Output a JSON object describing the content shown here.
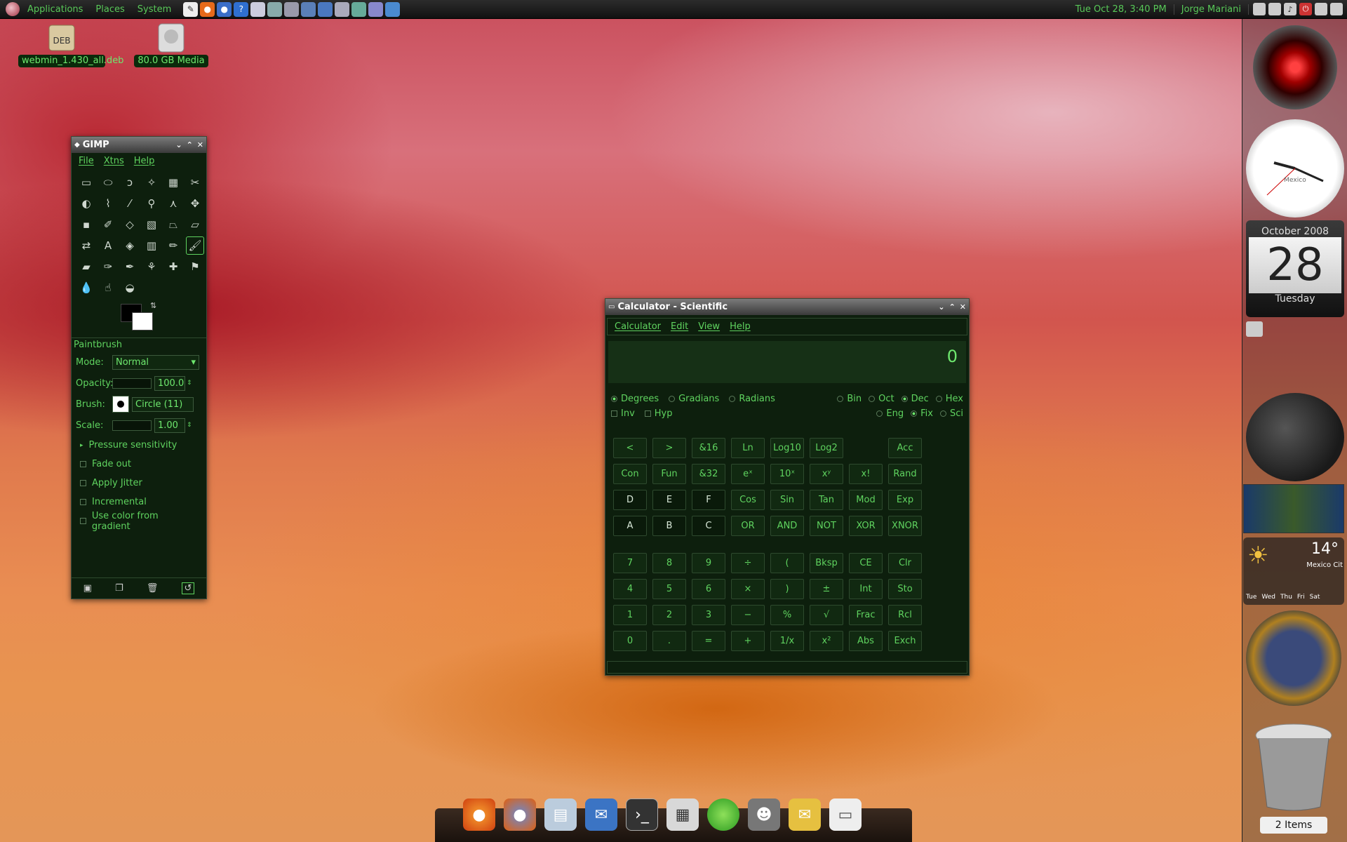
{
  "topbar": {
    "applications": "Applications",
    "places": "Places",
    "system": "System",
    "datetime": "Tue Oct 28,  3:40 PM",
    "user": "Jorge Mariani"
  },
  "desktop": {
    "icons": [
      {
        "label": "webmin_1.430_all.deb",
        "icon": "deb-package-icon"
      },
      {
        "label": "80.0 GB Media",
        "icon": "hard-drive-icon"
      }
    ]
  },
  "gimp": {
    "title": "GIMP",
    "menu": [
      "File",
      "Xtns",
      "Help"
    ],
    "tool_name": "Paintbrush",
    "mode_label": "Mode:",
    "mode_value": "Normal",
    "opacity_label": "Opacity:",
    "opacity_value": "100.0",
    "brush_label": "Brush:",
    "brush_value": "Circle (11)",
    "scale_label": "Scale:",
    "scale_value": "1.00",
    "pressure": "Pressure sensitivity",
    "options": [
      "Fade out",
      "Apply Jitter",
      "Incremental",
      "Use color from gradient"
    ]
  },
  "calc": {
    "title": "Calculator - Scientific",
    "menu": [
      "Calculator",
      "Edit",
      "View",
      "Help"
    ],
    "display": "0",
    "angle": [
      "Degrees",
      "Gradians",
      "Radians"
    ],
    "base": [
      "Bin",
      "Oct",
      "Dec",
      "Hex"
    ],
    "mods": [
      "Inv",
      "Hyp"
    ],
    "notation": [
      "Eng",
      "Fix",
      "Sci"
    ],
    "rows1": [
      [
        "<",
        "> ",
        "&16",
        "Ln",
        "Log10",
        "Log2",
        "",
        "Acc"
      ],
      [
        "Con",
        "Fun",
        "&32",
        "eˣ",
        "10ˣ",
        "xʸ",
        "x!",
        "Rand"
      ],
      [
        "D",
        "E",
        "F",
        "Cos",
        "Sin",
        "Tan",
        "Mod",
        "Exp"
      ],
      [
        "A",
        "B",
        "C",
        "OR",
        "AND",
        "NOT",
        "XOR",
        "XNOR"
      ]
    ],
    "rows2": [
      [
        "7",
        "8",
        "9",
        "÷",
        "(",
        "Bksp",
        "CE",
        "Clr"
      ],
      [
        "4",
        "5",
        "6",
        "×",
        ")",
        "±",
        "Int",
        "Sto"
      ],
      [
        "1",
        "2",
        "3",
        "−",
        "%",
        "√",
        "Frac",
        "Rcl"
      ],
      [
        "0",
        ".",
        "=",
        "+",
        "1/x",
        "x²",
        "Abs",
        "Exch"
      ]
    ]
  },
  "sidebar": {
    "cal_month": "October 2008",
    "cal_day": "28",
    "cal_weekday": "Tuesday",
    "weather_temp": "14°",
    "weather_city": "Mexico Cit",
    "weather_days": [
      "Tue",
      "Wed",
      "Thu",
      "Fri",
      "Sat"
    ],
    "trash_label": "2 Items",
    "clock_city": "Mexico"
  },
  "colors": {
    "accent": "#5fd35f",
    "window_bg": "#0d1f0d"
  }
}
